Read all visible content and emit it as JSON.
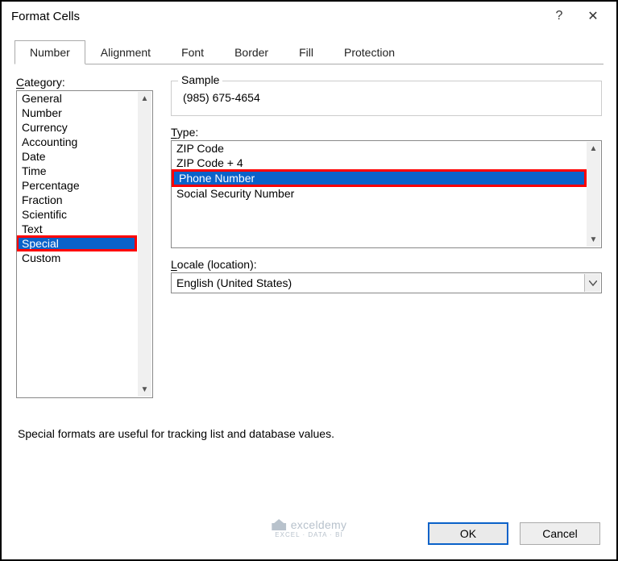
{
  "dialog": {
    "title": "Format Cells",
    "help": "?",
    "close": "✕"
  },
  "tabs": {
    "number": "Number",
    "alignment": "Alignment",
    "font": "Font",
    "border": "Border",
    "fill": "Fill",
    "protection": "Protection"
  },
  "category": {
    "label": "Category:",
    "items": {
      "general": "General",
      "number": "Number",
      "currency": "Currency",
      "accounting": "Accounting",
      "date": "Date",
      "time": "Time",
      "percentage": "Percentage",
      "fraction": "Fraction",
      "scientific": "Scientific",
      "text": "Text",
      "special": "Special",
      "custom": "Custom"
    }
  },
  "sample": {
    "label": "Sample",
    "value": "(985) 675-4654"
  },
  "type": {
    "label": "Type:",
    "items": {
      "zip": "ZIP Code",
      "zip4": "ZIP Code + 4",
      "phone": "Phone Number",
      "ssn": "Social Security Number"
    }
  },
  "locale": {
    "label": "Locale (location):",
    "value": "English (United States)"
  },
  "description": "Special formats are useful for tracking list and database values.",
  "buttons": {
    "ok": "OK",
    "cancel": "Cancel"
  },
  "watermark": {
    "brand": "exceldemy",
    "tag": "EXCEL · DATA · BI"
  }
}
